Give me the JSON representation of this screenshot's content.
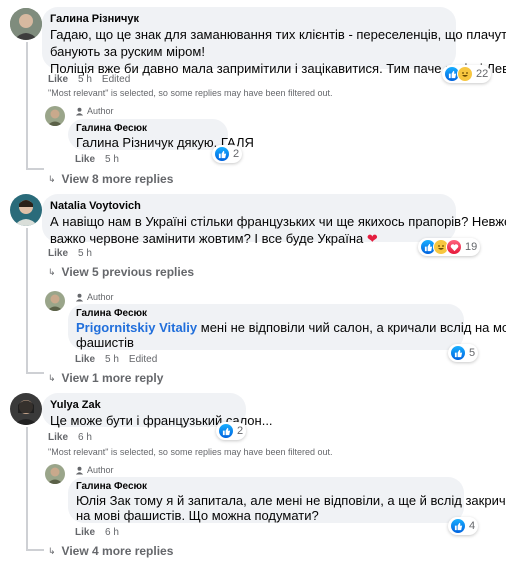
{
  "comments": [
    {
      "author": "Галина Різничук",
      "lines": [
        "Гадаю, що це знак для заманювання тих клієнтів - переселенців, що плачуть -",
        "банують за руским міром!",
        "Поліція вже би давно мала запримітили і зацікавитися. Тим паче в місті Лева!"
      ],
      "like": "Like",
      "time": "5 h",
      "edited": "Edited",
      "reactions_count": "22",
      "notice": "\"Most relevant\" is selected, so some replies may have been filtered out."
    },
    {
      "author_label": "Author",
      "author": "Галина Фесюк",
      "tag": "Галина Різничук",
      "text": " дякую. ГАЛЯ",
      "like": "Like",
      "time": "5 h",
      "reactions_count": "2"
    },
    {
      "author": "Natalia Voytovich",
      "lines": [
        "А навіщо нам в Україні стільки французьких чи ще якихось прапорів? Невже",
        "важко червоне замінити жовтим? І все буде Україна"
      ],
      "like": "Like",
      "time": "5 h",
      "reactions_count": "19"
    },
    {
      "author_label": "Author",
      "author": "Галина Фесюк",
      "tag": "Prigornitskiy Vitaliy",
      "text": " мені не відповіли чий салон, а кричали вслід на мові",
      "line2": "фашистів",
      "like": "Like",
      "time": "5 h",
      "edited": "Edited",
      "reactions_count": "5"
    },
    {
      "author": "Yulya Zak",
      "text": "Це може бути і французький салон...",
      "like": "Like",
      "time": "6 h",
      "reactions_count": "2",
      "notice": "\"Most relevant\" is selected, so some replies may have been filtered out."
    },
    {
      "author_label": "Author",
      "author": "Галина Фесюк",
      "lines": [
        "Юлія Зак тому я й запитала, але мені не відповіли, а ще й вслід закричали",
        "на мові фашистів. Що можна подумати?"
      ],
      "like": "Like",
      "time": "6 h",
      "reactions_count": "4"
    }
  ],
  "view_more": {
    "first": "View 8 more replies",
    "previous": "View 5 previous replies",
    "one": "View 1 more reply",
    "four": "View 4 more replies"
  },
  "colors": {
    "link": "#216fdb",
    "bubble": "#f0f2f5",
    "meta": "#65676b",
    "heart": "#e41e3f"
  }
}
